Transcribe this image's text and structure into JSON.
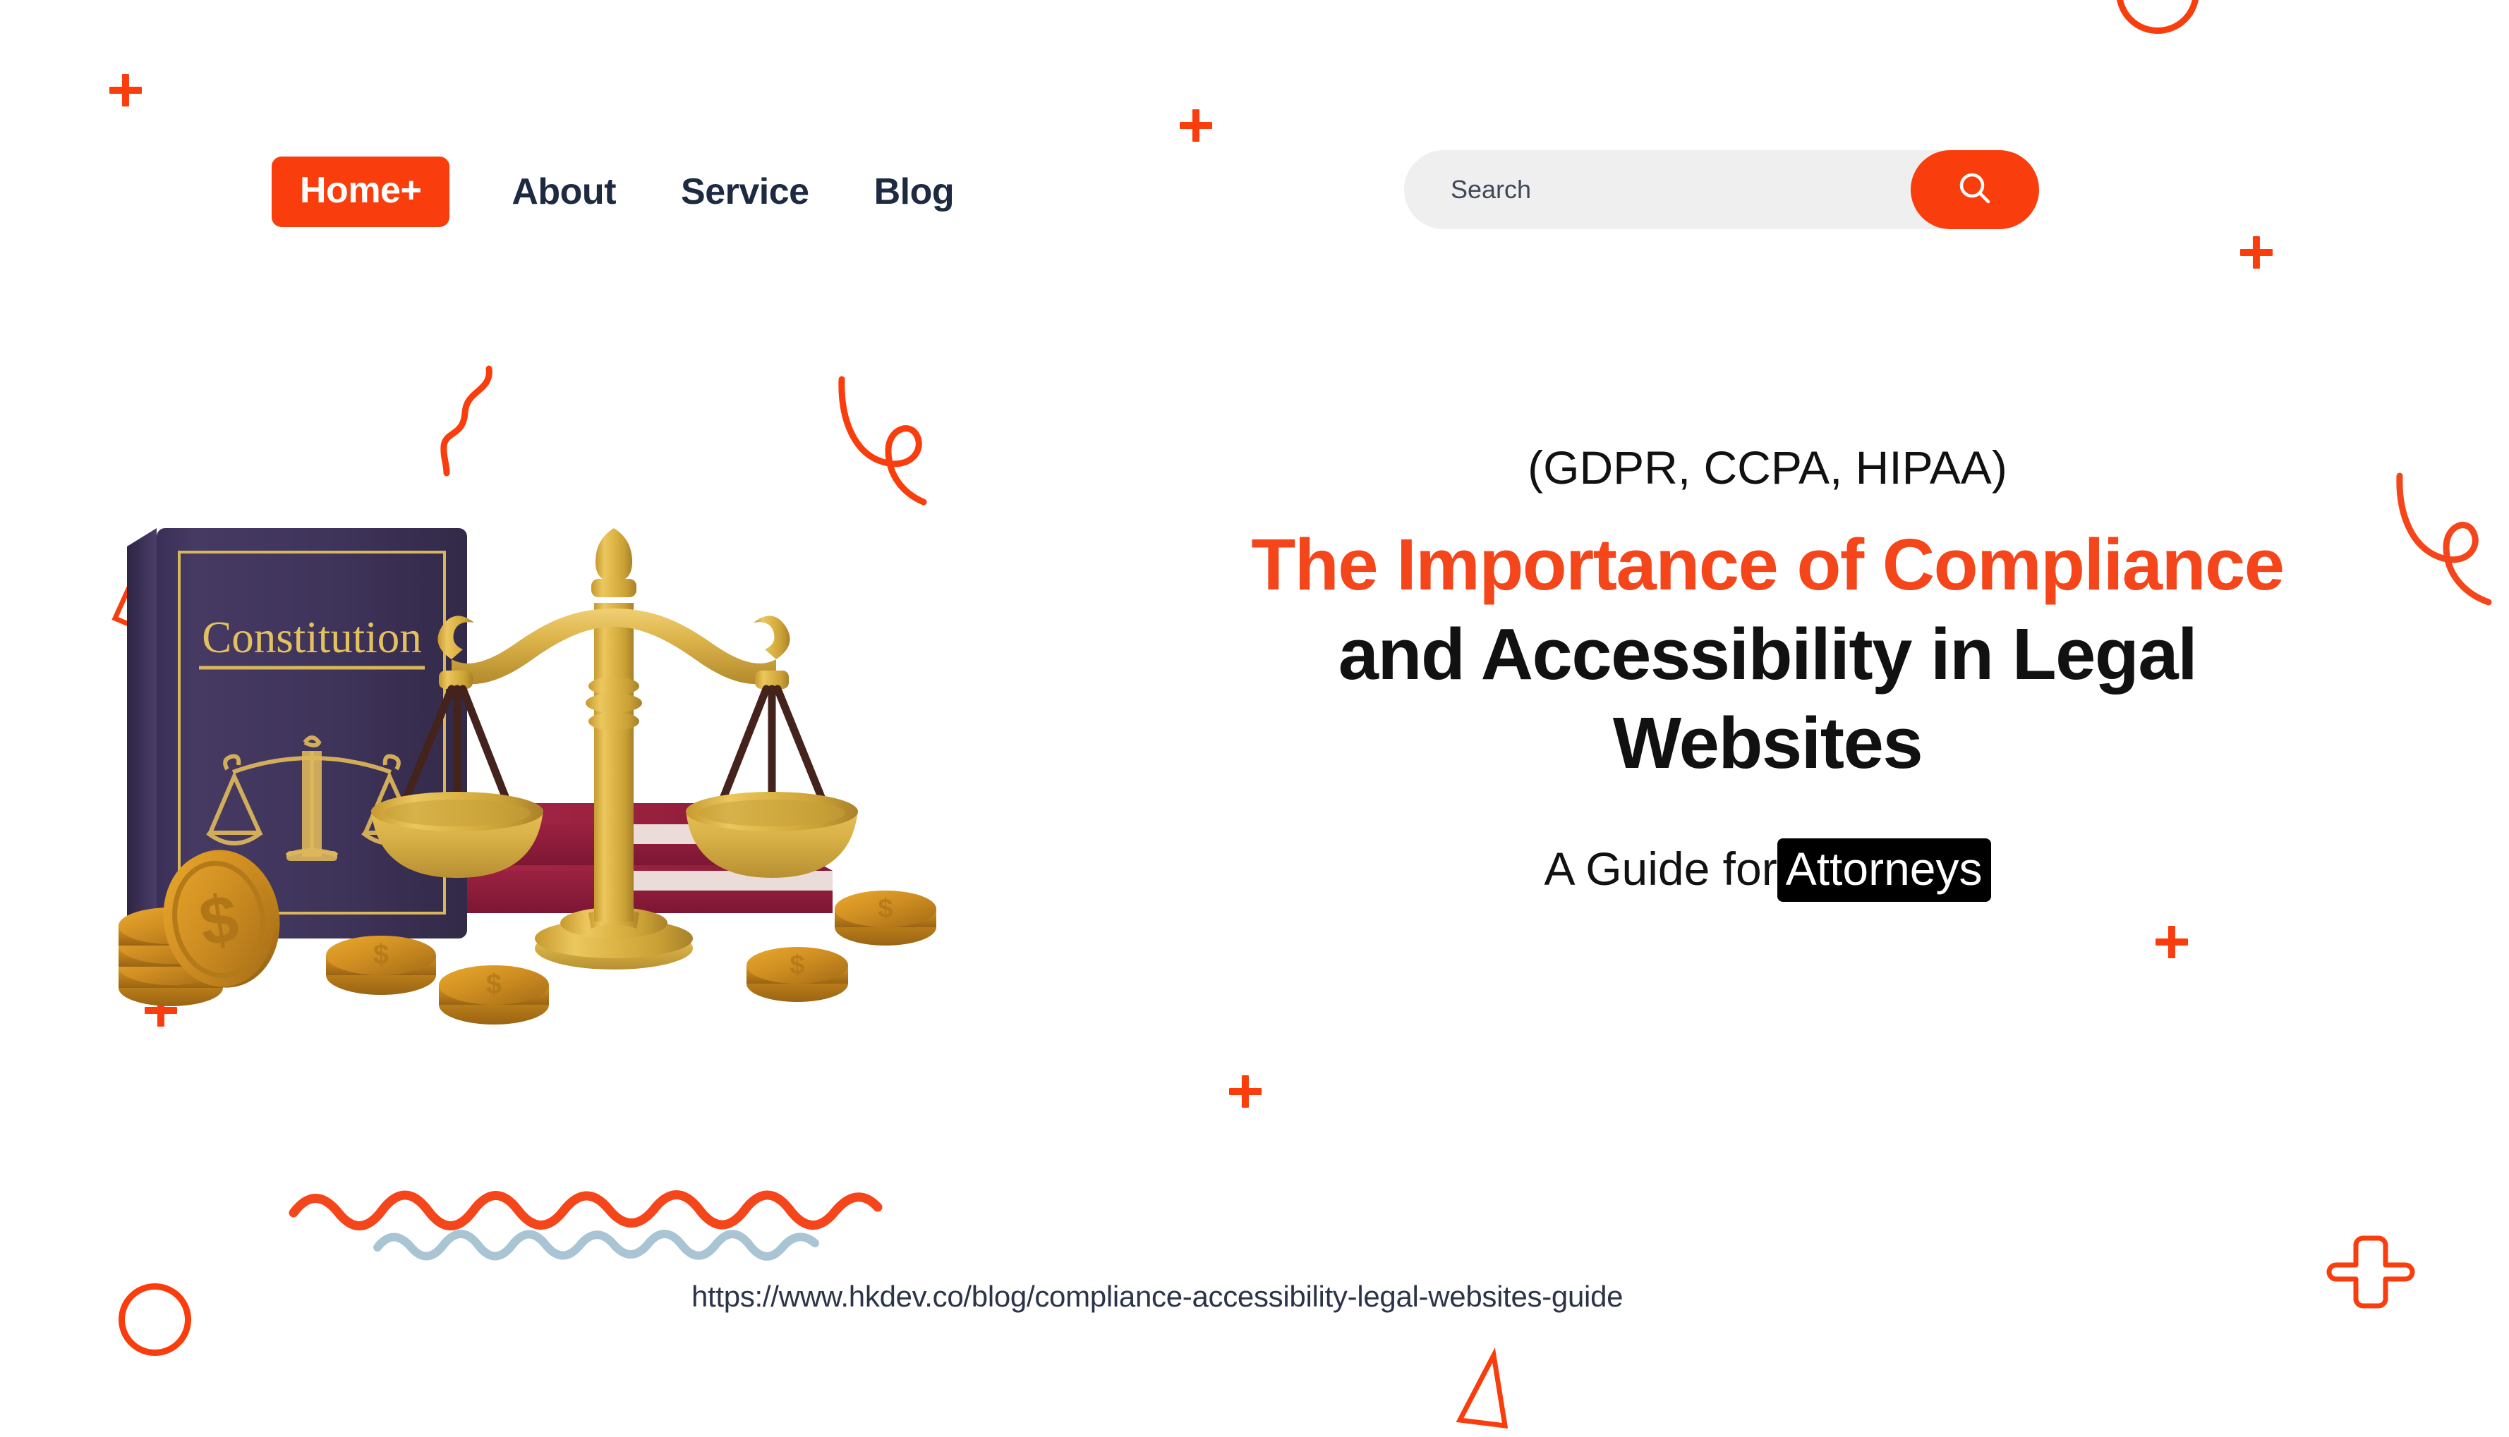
{
  "theme": {
    "accent_orange": "#F93D0C",
    "title_orange": "#F4451B",
    "nav_navy": "#1D2A42",
    "search_bg": "#EFEFEF",
    "text_black": "#111111",
    "wave_blue": "#A9C5D4",
    "background": "#FFFFFF"
  },
  "nav": {
    "home_label": "Home+",
    "links": [
      {
        "label": "About"
      },
      {
        "label": "Service"
      },
      {
        "label": "Blog"
      }
    ]
  },
  "search": {
    "placeholder": "Search",
    "value": "",
    "icon": "search-icon"
  },
  "hero": {
    "eyebrow": "(GDPR, CCPA, HIPAA)",
    "title_line1_accent": "The Importance of Compliance",
    "title_line2": "and Accessibility in Legal",
    "title_line3": "Websites",
    "subtitle_prefix": "A Guide for",
    "subtitle_highlight": "Attorneys"
  },
  "footer": {
    "url": "https://www.hkdev.co/blog/compliance-accessibility-legal-websites-guide"
  },
  "illustration": {
    "book_title": "Constitution",
    "elements": [
      "constitution-book",
      "scales-of-justice",
      "law-books-stack",
      "gold-coins"
    ]
  },
  "decorations": [
    {
      "name": "plus-top-left",
      "type": "plus-solid"
    },
    {
      "name": "plus-top-center",
      "type": "plus-solid"
    },
    {
      "name": "plus-right-upper",
      "type": "plus-solid"
    },
    {
      "name": "plus-left-lower",
      "type": "plus-solid"
    },
    {
      "name": "plus-mid-illustration",
      "type": "plus-solid"
    },
    {
      "name": "plus-bottom-center",
      "type": "plus-solid"
    },
    {
      "name": "plus-right-mid",
      "type": "plus-solid"
    },
    {
      "name": "plus-outline-bottom-right",
      "type": "plus-outline"
    },
    {
      "name": "circle-top-right",
      "type": "circle-ring"
    },
    {
      "name": "circle-bottom-left",
      "type": "circle-ring"
    },
    {
      "name": "triangle-left",
      "type": "triangle-outline"
    },
    {
      "name": "triangle-bottom-center",
      "type": "triangle-outline"
    },
    {
      "name": "squiggle-s-curve",
      "type": "squiggle"
    },
    {
      "name": "squiggle-loop-left",
      "type": "squiggle-loop"
    },
    {
      "name": "squiggle-loop-right",
      "type": "squiggle-loop"
    },
    {
      "name": "wave-orange",
      "type": "wave"
    },
    {
      "name": "wave-blue",
      "type": "wave"
    }
  ]
}
